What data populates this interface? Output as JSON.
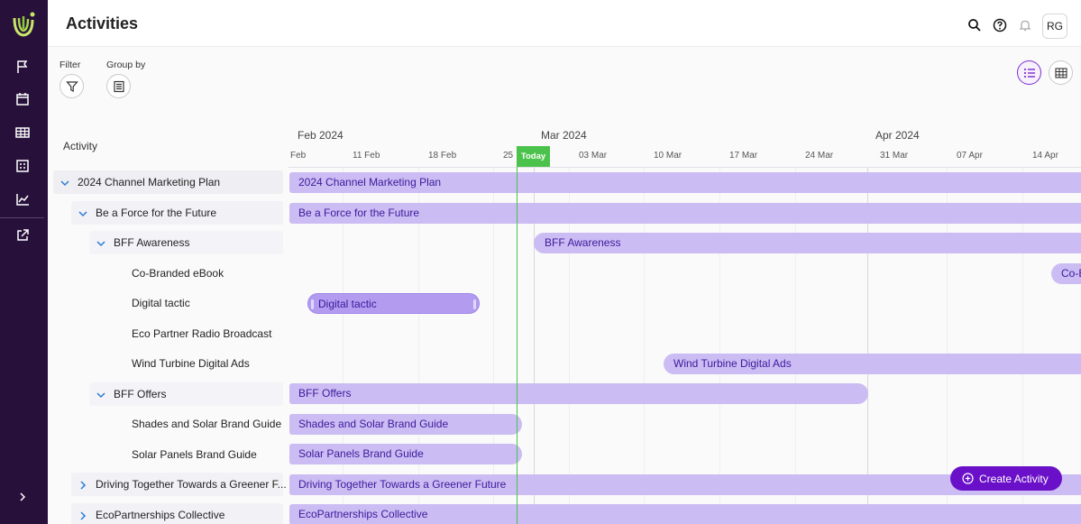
{
  "header": {
    "title": "Activities",
    "avatar_initials": "RG"
  },
  "toolbar": {
    "filter_label": "Filter",
    "group_by_label": "Group by"
  },
  "timeline": {
    "column_header": "Activity",
    "months": [
      "Feb 2024",
      "Mar 2024",
      "Apr 2024"
    ],
    "weeks": [
      "Feb",
      "11 Feb",
      "18 Feb",
      "25",
      "03 Mar",
      "10 Mar",
      "17 Mar",
      "24 Mar",
      "31 Mar",
      "07 Apr",
      "14 Apr"
    ],
    "today_label": "Today"
  },
  "tree": [
    {
      "label": "2024 Channel Marketing Plan",
      "bar": "2024 Channel Marketing Plan"
    },
    {
      "label": "Be a Force for the Future",
      "bar": "Be a Force for the Future"
    },
    {
      "label": "BFF Awareness",
      "bar": "BFF Awareness"
    },
    {
      "label": "Co-Branded eBook",
      "bar": "Co-B"
    },
    {
      "label": "Digital tactic",
      "bar": "Digital tactic"
    },
    {
      "label": "Eco Partner Radio Broadcast",
      "bar": ""
    },
    {
      "label": "Wind Turbine Digital Ads",
      "bar": "Wind Turbine Digital Ads"
    },
    {
      "label": "BFF Offers",
      "bar": "BFF Offers"
    },
    {
      "label": "Shades and Solar Brand Guide",
      "bar": "Shades and Solar Brand Guide"
    },
    {
      "label": "Solar Panels Brand Guide",
      "bar": "Solar Panels Brand Guide"
    },
    {
      "label": "Driving Together Towards a Greener F...",
      "bar": "Driving Together Towards a Greener Future"
    },
    {
      "label": "EcoPartnerships Collective",
      "bar": "EcoPartnerships Collective"
    }
  ],
  "actions": {
    "create_label": "Create Activity"
  },
  "colors": {
    "sidebar": "#27103a",
    "bar": "#cbbcf3",
    "bar_text": "#3b1a9c",
    "today": "#4bc24b",
    "accent": "#6b10c9"
  }
}
